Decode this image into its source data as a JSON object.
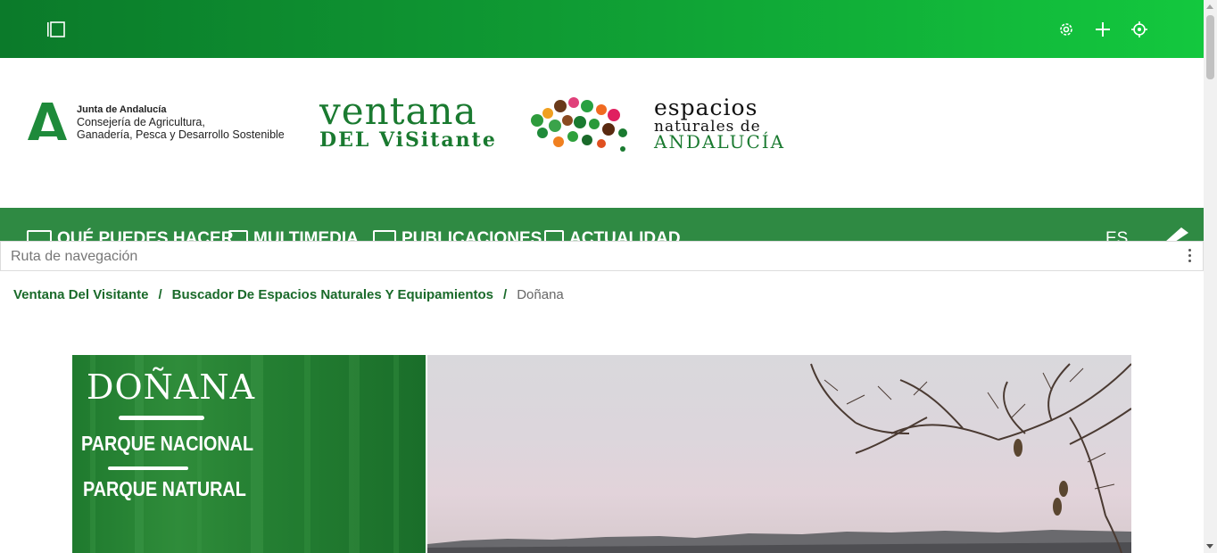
{
  "topbar": {
    "icons": [
      "sidebar-toggle-icon",
      "gear-icon",
      "plus-icon",
      "crosshair-icon"
    ],
    "color_start": "#0b7a2a",
    "color_end": "#13c83e"
  },
  "header": {
    "junta": {
      "line1": "Junta de Andalucía",
      "line2": "Consejería de Agricultura,",
      "line3": "Ganadería, Pesca y Desarrollo Sostenible"
    },
    "ventana": {
      "line1": "ventana",
      "line2": "DEL ViSitante"
    },
    "espacios": {
      "line1": "espacios",
      "line2": "naturales de",
      "line3": "ANDALUCÍA"
    }
  },
  "menu": {
    "items": [
      {
        "label": "QUÉ PUEDES HACER",
        "icon": "map-pin-icon"
      },
      {
        "label": "MULTIMEDIA",
        "icon": "play-icon"
      },
      {
        "label": "PUBLICACIONES",
        "icon": "book-icon"
      },
      {
        "label": "ACTUALIDAD",
        "icon": "calendar-icon"
      }
    ],
    "language": "ES"
  },
  "route_bar": {
    "placeholder": "Ruta de navegación"
  },
  "breadcrumb": {
    "items": [
      "Ventana Del Visitante",
      "Buscador De Espacios Naturales Y Equipamientos"
    ],
    "separator": "/",
    "current": "Doñana"
  },
  "hero": {
    "title": "DOÑANA",
    "line1": "PARQUE NACIONAL",
    "line2": "PARQUE NATURAL"
  },
  "colors": {
    "brand_green": "#1a7a30",
    "menu_green": "#2f8a43",
    "link_green": "#1a6a2a"
  }
}
